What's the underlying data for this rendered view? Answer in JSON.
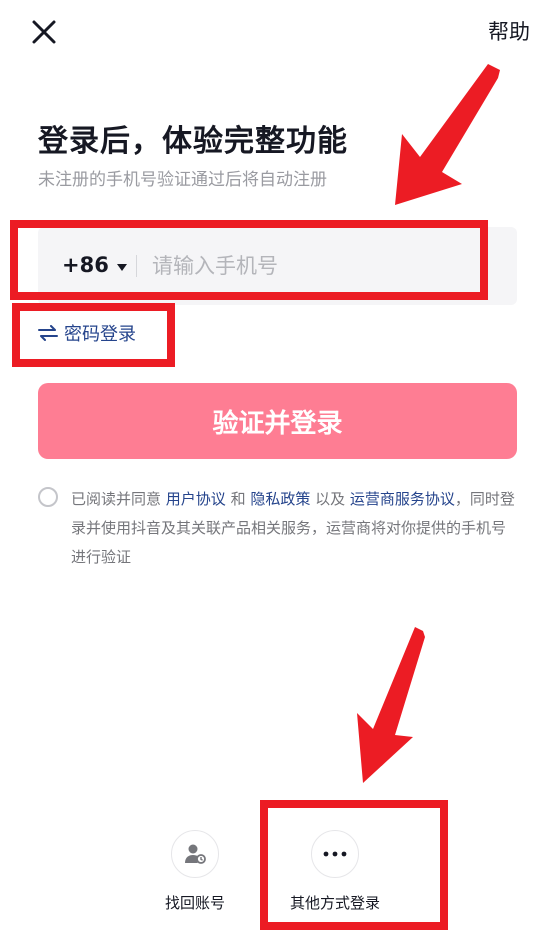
{
  "header": {
    "close_icon": "close-icon",
    "help_label": "帮助"
  },
  "main": {
    "title": "登录后，体验完整功能",
    "subtitle": "未注册的手机号验证通过后将自动注册",
    "phone": {
      "country_code": "+86",
      "placeholder": "请输入手机号",
      "value": ""
    },
    "password_login_label": "密码登录",
    "submit_label": "验证并登录"
  },
  "agreement": {
    "checked": false,
    "prefix": "已阅读并同意 ",
    "user_agreement": "用户协议",
    "and": " 和 ",
    "privacy_policy": "隐私政策",
    "and_also": " 以及 ",
    "carrier_agreement": "运营商服务协议",
    "suffix": "，同时登录并使用抖音及其关联产品相关服务，运营商将对你提供的手机号进行验证"
  },
  "bottom_options": [
    {
      "icon": "user-recover-icon",
      "label": "找回账号"
    },
    {
      "icon": "more-dots-icon",
      "label": "其他方式登录"
    }
  ],
  "colors": {
    "primary_button": "#fe7d93",
    "link": "#25448c",
    "annotation_red": "#ec1c24",
    "placeholder": "#b4b5ba",
    "subtitle": "#9a9ba1"
  }
}
